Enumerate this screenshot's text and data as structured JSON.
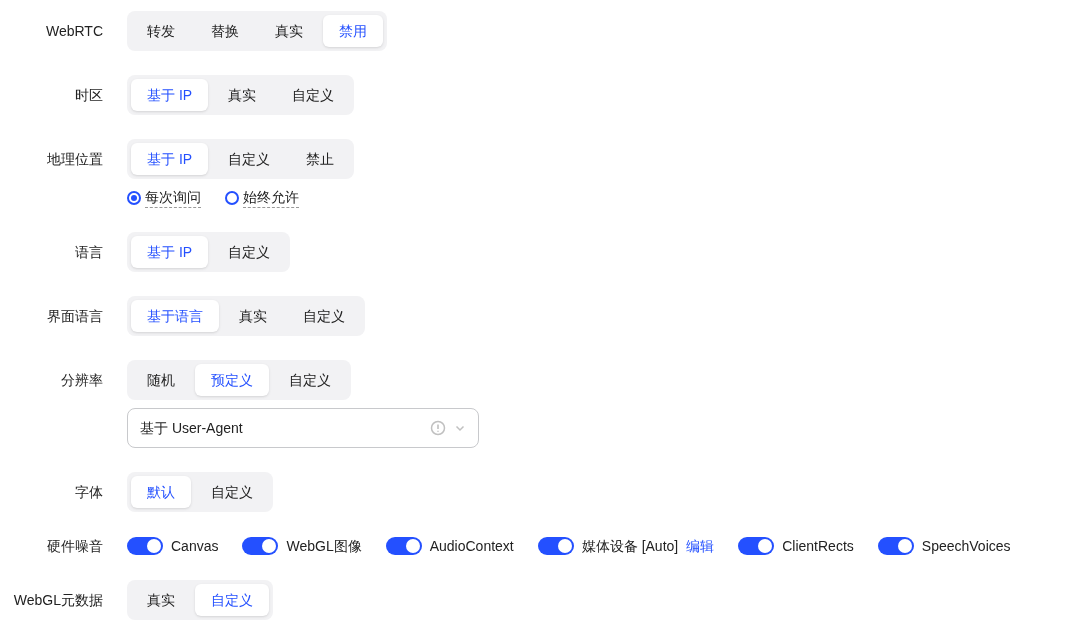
{
  "rows": [
    {
      "kind": "segmented",
      "label": "WebRTC",
      "options": [
        {
          "label": "转发",
          "selected": false
        },
        {
          "label": "替换",
          "selected": false
        },
        {
          "label": "真实",
          "selected": false
        },
        {
          "label": "禁用",
          "selected": true
        }
      ]
    },
    {
      "kind": "segmented",
      "label": "时区",
      "options": [
        {
          "label": "基于 IP",
          "selected": true
        },
        {
          "label": "真实",
          "selected": false
        },
        {
          "label": "自定义",
          "selected": false
        }
      ]
    },
    {
      "kind": "segmented",
      "label": "地理位置",
      "options": [
        {
          "label": "基于 IP",
          "selected": true
        },
        {
          "label": "自定义",
          "selected": false
        },
        {
          "label": "禁止",
          "selected": false
        }
      ],
      "radios": [
        {
          "label": "每次询问",
          "selected": true
        },
        {
          "label": "始终允许",
          "selected": false
        }
      ]
    },
    {
      "kind": "segmented",
      "label": "语言",
      "options": [
        {
          "label": "基于 IP",
          "selected": true
        },
        {
          "label": "自定义",
          "selected": false
        }
      ]
    },
    {
      "kind": "segmented",
      "label": "界面语言",
      "options": [
        {
          "label": "基于语言",
          "selected": true
        },
        {
          "label": "真实",
          "selected": false
        },
        {
          "label": "自定义",
          "selected": false
        }
      ]
    },
    {
      "kind": "segmented",
      "label": "分辨率",
      "options": [
        {
          "label": "随机",
          "selected": false
        },
        {
          "label": "预定义",
          "selected": true
        },
        {
          "label": "自定义",
          "selected": false
        }
      ],
      "select": {
        "value": "基于 User-Agent"
      }
    },
    {
      "kind": "segmented",
      "label": "字体",
      "options": [
        {
          "label": "默认",
          "selected": true
        },
        {
          "label": "自定义",
          "selected": false
        }
      ]
    },
    {
      "kind": "toggles",
      "label": "硬件噪音",
      "toggles": [
        {
          "label": "Canvas",
          "on": true
        },
        {
          "label": "WebGL图像",
          "on": true
        },
        {
          "label": "AudioContext",
          "on": true
        },
        {
          "label": "媒体设备 [Auto]",
          "on": true,
          "link": "编辑"
        },
        {
          "label": "ClientRects",
          "on": true
        },
        {
          "label": "SpeechVoices",
          "on": true
        }
      ]
    },
    {
      "kind": "segmented",
      "label": "WebGL元数据",
      "options": [
        {
          "label": "真实",
          "selected": false
        },
        {
          "label": "自定义",
          "selected": true
        }
      ]
    }
  ]
}
